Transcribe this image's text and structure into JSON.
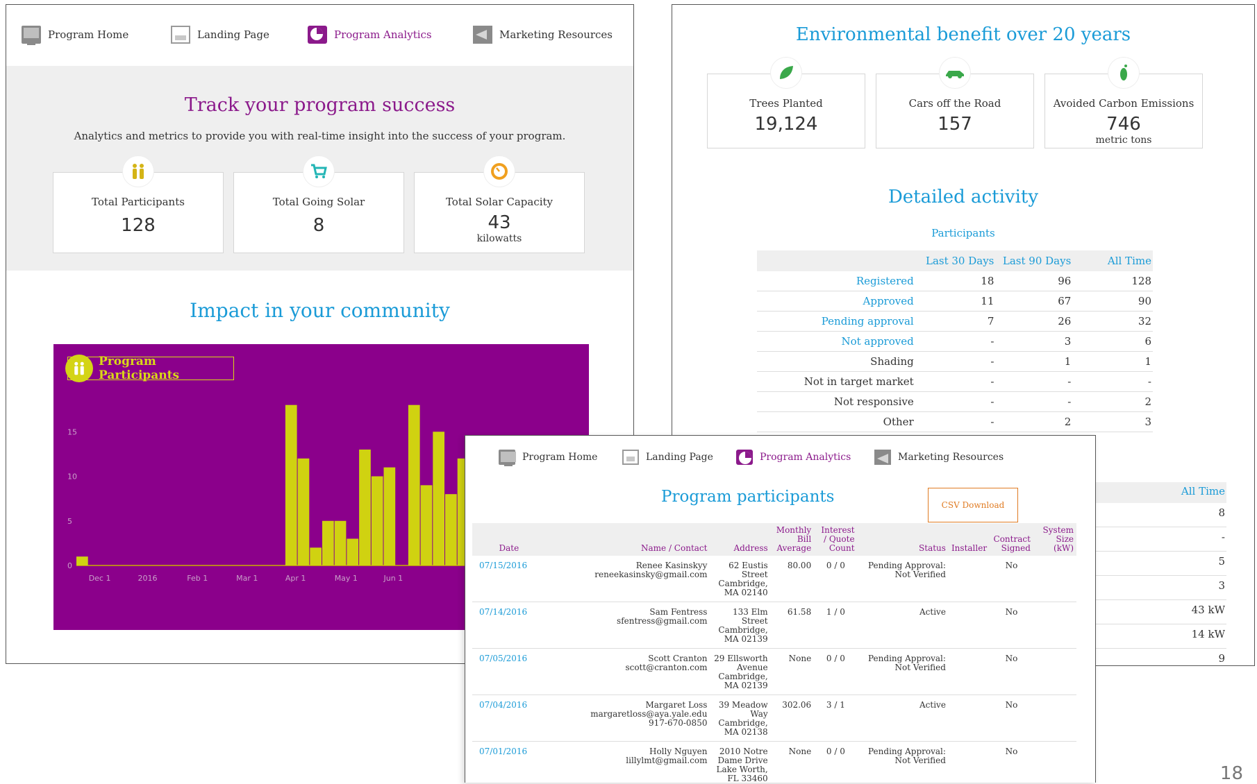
{
  "nav": {
    "home": "Program Home",
    "landing": "Landing Page",
    "analytics": "Program Analytics",
    "marketing": "Marketing Resources"
  },
  "track": {
    "title": "Track your program success",
    "subtitle": "Analytics and metrics to provide you with real-time insight into the success of your program.",
    "stats": [
      {
        "label": "Total Participants",
        "value": "128",
        "unit": "",
        "icon": "participants-icon"
      },
      {
        "label": "Total Going Solar",
        "value": "8",
        "unit": "",
        "icon": "cart-icon"
      },
      {
        "label": "Total Solar Capacity",
        "value": "43",
        "unit": "kilowatts",
        "icon": "gauge-icon"
      }
    ]
  },
  "impact": {
    "title": "Impact in your community",
    "legend": "Program Participants"
  },
  "chart_data": {
    "type": "bar",
    "title": "",
    "xlabel": "",
    "ylabel": "",
    "ylim": [
      0,
      20
    ],
    "yticks": [
      0,
      5,
      10,
      15
    ],
    "xtick_labels": [
      "Dec 1",
      "2016",
      "Feb 1",
      "Mar 1",
      "Apr 1",
      "May 1",
      "Jun 1"
    ],
    "xtick_positions": [
      1,
      5,
      9,
      13,
      17,
      21,
      25
    ],
    "values": [
      1,
      0,
      0,
      0,
      0,
      0,
      0,
      0,
      0,
      0,
      0,
      0,
      0,
      0,
      0,
      0,
      0,
      18,
      12,
      2,
      5,
      5,
      3,
      13,
      10,
      11,
      0,
      18,
      9,
      15,
      8,
      12
    ],
    "legend": "Program Participants",
    "colors": {
      "bar": "#d0d211",
      "background": "#8b008b"
    },
    "legend_position": "top-left",
    "grid": false
  },
  "env": {
    "title": "Environmental benefit over 20 years",
    "stats": [
      {
        "label": "Trees Planted",
        "value": "19,124",
        "unit": "",
        "icon": "leaf-icon"
      },
      {
        "label": "Cars off the Road",
        "value": "157",
        "unit": "",
        "icon": "car-icon"
      },
      {
        "label": "Avoided Carbon Emissions",
        "value": "746",
        "unit": "metric tons",
        "icon": "footprint-icon"
      }
    ]
  },
  "activity": {
    "title": "Detailed activity",
    "subtitle": "Participants",
    "columns": [
      "",
      "Last 30 Days",
      "Last 90 Days",
      "All Time"
    ],
    "rows": [
      {
        "label": "Registered",
        "link": true,
        "d30": "18",
        "d90": "96",
        "all": "128"
      },
      {
        "label": "Approved",
        "link": true,
        "d30": "11",
        "d90": "67",
        "all": "90"
      },
      {
        "label": "Pending approval",
        "link": true,
        "d30": "7",
        "d90": "26",
        "all": "32"
      },
      {
        "label": "Not approved",
        "link": true,
        "d30": "-",
        "d90": "3",
        "all": "6"
      },
      {
        "label": "Shading",
        "link": false,
        "d30": "-",
        "d90": "1",
        "all": "1"
      },
      {
        "label": "Not in target market",
        "link": false,
        "d30": "-",
        "d90": "-",
        "all": "-"
      },
      {
        "label": "Not responsive",
        "link": false,
        "d30": "-",
        "d90": "-",
        "all": "2"
      },
      {
        "label": "Other",
        "link": false,
        "d30": "-",
        "d90": "2",
        "all": "3"
      }
    ],
    "second_header": "All Time",
    "second_values": [
      "8",
      "-",
      "5",
      "3",
      "43 kW",
      "14 kW",
      "9"
    ]
  },
  "participants": {
    "title": "Program participants",
    "csv": "CSV Download",
    "columns": {
      "date": "Date",
      "name": "Name / Contact",
      "address": "Address",
      "bill": "Monthly Bill Average",
      "interest": "Interest / Quote Count",
      "status": "Status",
      "installer": "Installer",
      "contract": "Contract Signed",
      "size": "System Size (kW)"
    },
    "rows": [
      {
        "date": "07/15/2016",
        "name": "Renee Kasinskyy",
        "email": "reneekasinsky@gmail.com",
        "phone": "",
        "addr1": "62 Eustis",
        "addr2": "Street",
        "addr3": "Cambridge,",
        "addr4": "MA 02140",
        "bill": "80.00",
        "interest": "0 / 0",
        "status1": "Pending Approval:",
        "status2": "Not Verified",
        "installer": "",
        "contract": "No",
        "size": ""
      },
      {
        "date": "07/14/2016",
        "name": "Sam Fentress",
        "email": "sfentress@gmail.com",
        "phone": "",
        "addr1": "133 Elm",
        "addr2": "Street",
        "addr3": "Cambridge,",
        "addr4": "MA 02139",
        "bill": "61.58",
        "interest": "1 / 0",
        "status1": "Active",
        "status2": "",
        "installer": "",
        "contract": "No",
        "size": ""
      },
      {
        "date": "07/05/2016",
        "name": "Scott Cranton",
        "email": "scott@cranton.com",
        "phone": "",
        "addr1": "29 Ellsworth",
        "addr2": "Avenue",
        "addr3": "Cambridge,",
        "addr4": "MA 02139",
        "bill": "None",
        "interest": "0 / 0",
        "status1": "Pending Approval:",
        "status2": "Not Verified",
        "installer": "",
        "contract": "No",
        "size": ""
      },
      {
        "date": "07/04/2016",
        "name": "Margaret Loss",
        "email": "margaretloss@aya.yale.edu",
        "phone": "917-670-0850",
        "addr1": "39 Meadow",
        "addr2": "Way",
        "addr3": "Cambridge,",
        "addr4": "MA 02138",
        "bill": "302.06",
        "interest": "3 / 1",
        "status1": "Active",
        "status2": "",
        "installer": "",
        "contract": "No",
        "size": ""
      },
      {
        "date": "07/01/2016",
        "name": "Holly Nguyen",
        "email": "lillylmt@gmail.com",
        "phone": "",
        "addr1": "2010 Notre",
        "addr2": "Dame Drive",
        "addr3": "Lake Worth,",
        "addr4": "FL 33460",
        "bill": "None",
        "interest": "0 / 0",
        "status1": "Pending Approval:",
        "status2": "Not Verified",
        "installer": "",
        "contract": "No",
        "size": ""
      }
    ]
  },
  "page_number": "18"
}
